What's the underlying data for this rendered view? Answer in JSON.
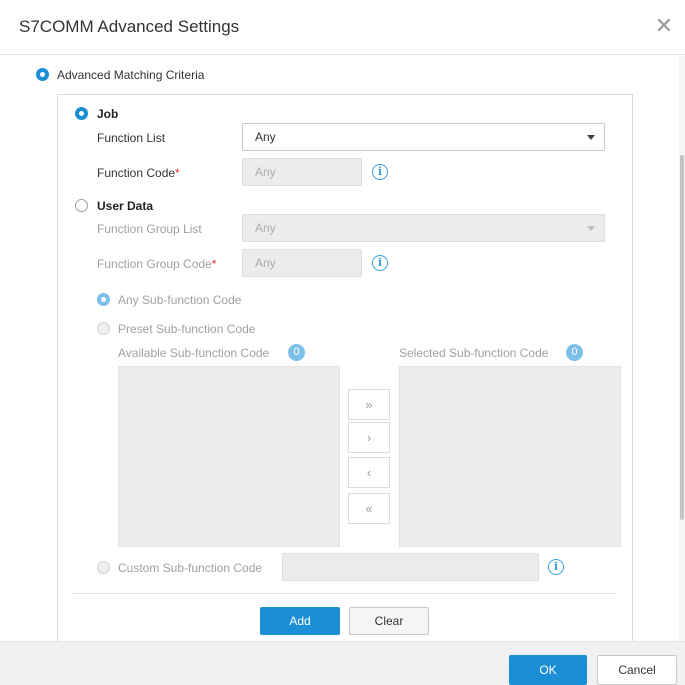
{
  "dialog": {
    "title": "S7COMM Advanced Settings",
    "close_icon": "close-icon"
  },
  "criteria": {
    "label": "Advanced Matching Criteria",
    "job": {
      "label": "Job",
      "function_list_label": "Function List",
      "function_list_value": "Any",
      "function_code_label": "Function Code",
      "function_code_placeholder": "Any"
    },
    "user_data": {
      "label": "User Data",
      "function_group_list_label": "Function Group List",
      "function_group_list_value": "Any",
      "function_group_code_label": "Function Group Code",
      "function_group_code_placeholder": "Any",
      "any_subfunction_label": "Any Sub-function Code",
      "preset_subfunction_label": "Preset Sub-function Code",
      "available_label": "Available Sub-function Code",
      "available_count": "0",
      "selected_label": "Selected Sub-function Code",
      "selected_count": "0",
      "move_all_right": "»",
      "move_right": "›",
      "move_left": "‹",
      "move_all_left": "«",
      "custom_subfunction_label": "Custom Sub-function Code"
    },
    "required_mark": "*",
    "add_label": "Add",
    "clear_label": "Clear"
  },
  "footer": {
    "ok_label": "OK",
    "cancel_label": "Cancel"
  },
  "colors": {
    "accent": "#1b8fd6",
    "accent_light": "#7cc0ea",
    "required": "#e0302a"
  }
}
